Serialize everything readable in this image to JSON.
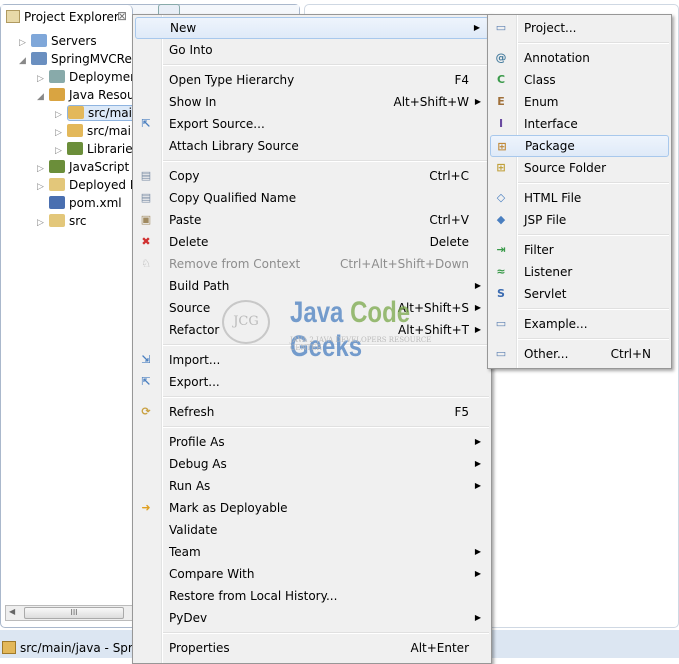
{
  "explorer": {
    "tab_title": "Project Explorer",
    "close_glyph": "⊠",
    "tree": [
      {
        "label": "Servers",
        "depth": 0,
        "twisty": "▷",
        "icon": "folder-icon",
        "color": "#7fa7d9"
      },
      {
        "label": "SpringMVCRed",
        "depth": 0,
        "twisty": "◢",
        "icon": "project-icon",
        "color": "#6a8fc0"
      },
      {
        "label": "Deploymen",
        "depth": 1,
        "twisty": "▷",
        "icon": "deployment-descriptor-icon",
        "color": "#8aa"
      },
      {
        "label": "Java Resour",
        "depth": 1,
        "twisty": "◢",
        "icon": "java-resources-icon",
        "color": "#d9a441"
      },
      {
        "label": "src/main",
        "depth": 2,
        "twisty": "▷",
        "icon": "source-folder-icon",
        "color": "#e3b85a",
        "selected": true
      },
      {
        "label": "src/main",
        "depth": 2,
        "twisty": "▷",
        "icon": "source-folder-icon",
        "color": "#e3b85a"
      },
      {
        "label": "Libraries",
        "depth": 2,
        "twisty": "▷",
        "icon": "libraries-icon",
        "color": "#6b8e3a"
      },
      {
        "label": "JavaScript R",
        "depth": 1,
        "twisty": "▷",
        "icon": "libraries-icon",
        "color": "#6b8e3a"
      },
      {
        "label": "Deployed R",
        "depth": 1,
        "twisty": "▷",
        "icon": "deployed-resources-icon",
        "color": "#e3c77a"
      },
      {
        "label": "pom.xml",
        "depth": 1,
        "twisty": "",
        "icon": "maven-file-icon",
        "color": "#4a6fb0"
      },
      {
        "label": "src",
        "depth": 1,
        "twisty": "▷",
        "icon": "folder-icon",
        "color": "#e3c77a"
      }
    ],
    "scroll_thumb": "III"
  },
  "status": {
    "text": "src/main/java - Sprin"
  },
  "watermark": {
    "title_java": "Java",
    "title_code": "Code",
    "title_geeks": "Geeks",
    "logo": "JCG",
    "subtitle": "JAVA 2 JAVA DEVELOPERS RESOURCE CENTER"
  },
  "context_menu": [
    {
      "label": "New",
      "submenu": true,
      "highlight": true
    },
    {
      "label": "Go Into"
    },
    {
      "sep": true
    },
    {
      "label": "Open Type Hierarchy",
      "shortcut": "F4"
    },
    {
      "label": "Show In",
      "shortcut": "Alt+Shift+W",
      "submenu": true
    },
    {
      "label": "Export Source...",
      "icon": "export-source-icon",
      "glyph": "⇱",
      "color": "#4a7fc0"
    },
    {
      "label": "Attach Library Source"
    },
    {
      "sep": true
    },
    {
      "label": "Copy",
      "shortcut": "Ctrl+C",
      "icon": "copy-icon",
      "glyph": "▤",
      "color": "#7a8da5"
    },
    {
      "label": "Copy Qualified Name",
      "icon": "copy-qualified-name-icon",
      "glyph": "▤",
      "color": "#7a8da5"
    },
    {
      "label": "Paste",
      "shortcut": "Ctrl+V",
      "icon": "paste-icon",
      "glyph": "▣",
      "color": "#a08a60"
    },
    {
      "label": "Delete",
      "shortcut": "Delete",
      "icon": "delete-icon",
      "glyph": "✖",
      "color": "#d03030"
    },
    {
      "label": "Remove from Context",
      "shortcut": "Ctrl+Alt+Shift+Down",
      "disabled": true,
      "icon": "remove-context-icon",
      "glyph": "♘",
      "color": "#aaa"
    },
    {
      "label": "Build Path",
      "submenu": true
    },
    {
      "label": "Source",
      "shortcut": "Alt+Shift+S",
      "submenu": true
    },
    {
      "label": "Refactor",
      "shortcut": "Alt+Shift+T",
      "submenu": true
    },
    {
      "sep": true
    },
    {
      "label": "Import...",
      "icon": "import-icon",
      "glyph": "⇲",
      "color": "#4a7fc0"
    },
    {
      "label": "Export...",
      "icon": "export-icon",
      "glyph": "⇱",
      "color": "#4a7fc0"
    },
    {
      "sep": true
    },
    {
      "label": "Refresh",
      "shortcut": "F5",
      "icon": "refresh-icon",
      "glyph": "⟳",
      "color": "#c9a040"
    },
    {
      "sep": true
    },
    {
      "label": "Profile As",
      "submenu": true
    },
    {
      "label": "Debug As",
      "submenu": true
    },
    {
      "label": "Run As",
      "submenu": true
    },
    {
      "label": "Mark as Deployable",
      "icon": "mark-deployable-icon",
      "glyph": "➜",
      "color": "#e0a020"
    },
    {
      "label": "Validate"
    },
    {
      "label": "Team",
      "submenu": true
    },
    {
      "label": "Compare With",
      "submenu": true
    },
    {
      "label": "Restore from Local History..."
    },
    {
      "label": "PyDev",
      "submenu": true
    },
    {
      "sep": true
    },
    {
      "label": "Properties",
      "shortcut": "Alt+Enter"
    }
  ],
  "new_submenu": [
    {
      "label": "Project...",
      "icon": "new-project-icon",
      "glyph": "▭",
      "color": "#5a7fb0"
    },
    {
      "sep": true
    },
    {
      "label": "Annotation",
      "icon": "annotation-icon",
      "glyph": "@",
      "color": "#4a7fa0"
    },
    {
      "label": "Class",
      "icon": "class-icon",
      "glyph": "C",
      "color": "#3a9a4a"
    },
    {
      "label": "Enum",
      "icon": "enum-icon",
      "glyph": "E",
      "color": "#a0703a"
    },
    {
      "label": "Interface",
      "icon": "interface-icon",
      "glyph": "I",
      "color": "#6a4aa0"
    },
    {
      "label": "Package",
      "icon": "package-icon",
      "glyph": "⊞",
      "color": "#c08a3a",
      "highlight": true
    },
    {
      "label": "Source Folder",
      "icon": "source-folder-icon",
      "glyph": "⊞",
      "color": "#c0a03a"
    },
    {
      "sep": true
    },
    {
      "label": "HTML File",
      "icon": "html-file-icon",
      "glyph": "◇",
      "color": "#4a7fc0"
    },
    {
      "label": "JSP File",
      "icon": "jsp-file-icon",
      "glyph": "◆",
      "color": "#4a7fc0"
    },
    {
      "sep": true
    },
    {
      "label": "Filter",
      "icon": "filter-icon",
      "glyph": "⇥",
      "color": "#3a9a4a"
    },
    {
      "label": "Listener",
      "icon": "listener-icon",
      "glyph": "≈",
      "color": "#3a9a4a"
    },
    {
      "label": "Servlet",
      "icon": "servlet-icon",
      "glyph": "S",
      "color": "#3a6ab0"
    },
    {
      "sep": true
    },
    {
      "label": "Example...",
      "icon": "example-icon",
      "glyph": "▭",
      "color": "#5a7fb0"
    },
    {
      "sep": true
    },
    {
      "label": "Other...",
      "shortcut": "Ctrl+N",
      "icon": "other-icon",
      "glyph": "▭",
      "color": "#5a7fb0"
    }
  ]
}
